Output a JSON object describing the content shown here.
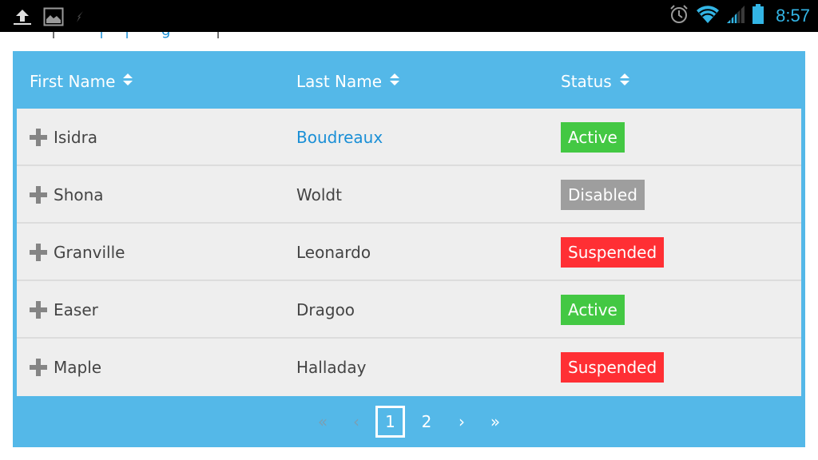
{
  "status_bar": {
    "left_icons": [
      "upload-icon",
      "gallery-icon",
      "no-signal-icon"
    ],
    "right_icons": [
      "alarm-icon",
      "wifi-icon",
      "cell-signal-icon",
      "battery-icon"
    ],
    "time": "8:57",
    "accent_color": "#33b5e5"
  },
  "table": {
    "header_color": "#54b8e8",
    "columns": [
      {
        "label": "First Name",
        "icon": "sort-icon"
      },
      {
        "label": "Last Name",
        "icon": "sort-icon"
      },
      {
        "label": "Status",
        "icon": "sort-icon"
      }
    ],
    "rows": [
      {
        "first": "Isidra",
        "last": "Boudreaux",
        "status": "Active",
        "last_is_link": true
      },
      {
        "first": "Shona",
        "last": "Woldt",
        "status": "Disabled"
      },
      {
        "first": "Granville",
        "last": "Leonardo",
        "status": "Suspended"
      },
      {
        "first": "Easer",
        "last": "Dragoo",
        "status": "Active"
      },
      {
        "first": "Maple",
        "last": "Halladay",
        "status": "Suspended"
      }
    ],
    "status_colors": {
      "Active": "#43c843",
      "Disabled": "#9e9e9e",
      "Suspended": "#ff2f34"
    }
  },
  "pagination": {
    "first": "«",
    "prev": "‹",
    "pages": [
      "1",
      "2"
    ],
    "current_page": "1",
    "next": "›",
    "last": "»"
  }
}
